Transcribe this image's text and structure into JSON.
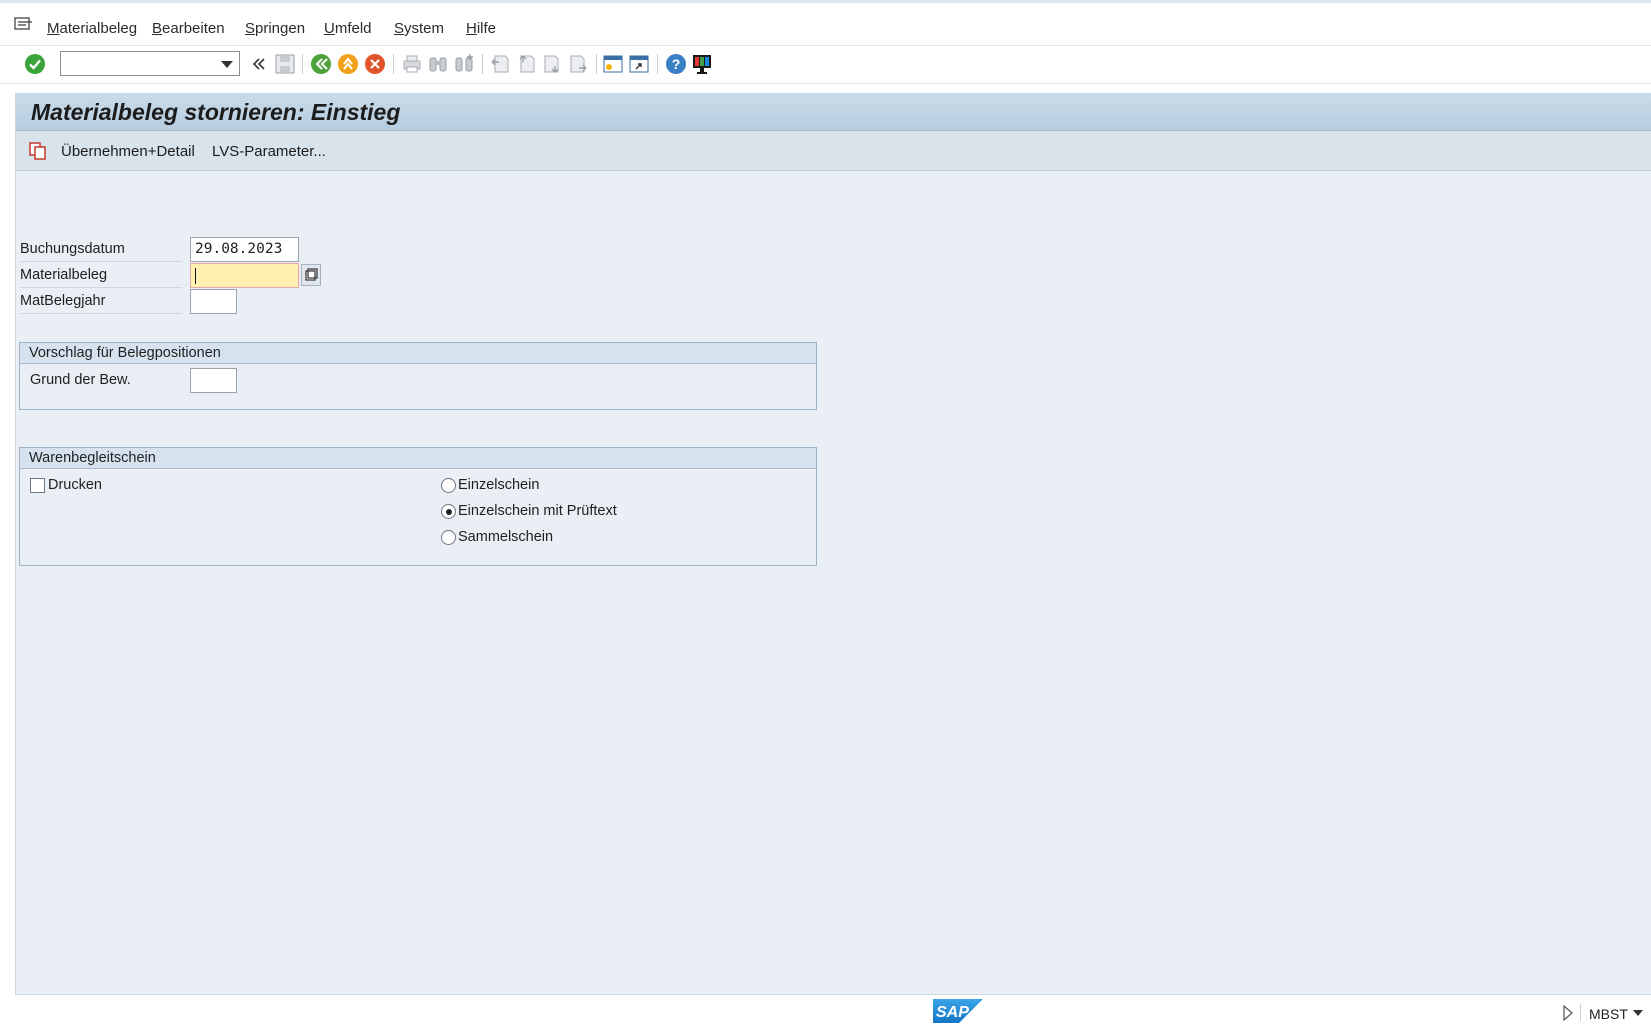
{
  "menu": {
    "items": [
      {
        "label": "Materialbeleg"
      },
      {
        "label": "Bearbeiten"
      },
      {
        "label": "Springen"
      },
      {
        "label": "Umfeld"
      },
      {
        "label": "System"
      },
      {
        "label": "Hilfe"
      }
    ]
  },
  "toolbar": {
    "command_field_value": "",
    "icons": [
      "enter-icon",
      "command-field",
      "collapse-icon",
      "save-icon",
      "back-icon",
      "exit-icon",
      "cancel-icon",
      "print-icon",
      "find-icon",
      "find-next-icon",
      "first-page-icon",
      "prev-page-icon",
      "next-page-icon",
      "last-page-icon",
      "new-session-icon",
      "shortcut-icon",
      "help-icon",
      "customize-layout-icon"
    ]
  },
  "screen": {
    "title": "Materialbeleg stornieren: Einstieg",
    "app_buttons": [
      {
        "label": "Übernehmen+Detail",
        "icon": "copy-detail-icon"
      },
      {
        "label": "LVS-Parameter..."
      }
    ]
  },
  "fields": {
    "buchungsdatum": {
      "label": "Buchungsdatum",
      "value": "29.08.2023"
    },
    "materialbeleg": {
      "label": "Materialbeleg",
      "value": ""
    },
    "matbelegjahr": {
      "label": "MatBelegjahr",
      "value": ""
    }
  },
  "group_vorschlag": {
    "title": "Vorschlag für Belegpositionen",
    "grund": {
      "label": "Grund der Bew.",
      "value": ""
    }
  },
  "group_waren": {
    "title": "Warenbegleitschein",
    "drucken": {
      "label": "Drucken",
      "checked": false
    },
    "options": [
      {
        "label": "Einzelschein",
        "selected": false
      },
      {
        "label": "Einzelschein mit Prüftext",
        "selected": true
      },
      {
        "label": "Sammelschein",
        "selected": false
      }
    ]
  },
  "status": {
    "logo": "SAP",
    "tcode": "MBST"
  },
  "colors": {
    "title_bg": "#c9dbe9",
    "main_bg": "#e9eff5",
    "focus_field": "#fdf0b1",
    "sap_blue": "#1b8ad6"
  }
}
